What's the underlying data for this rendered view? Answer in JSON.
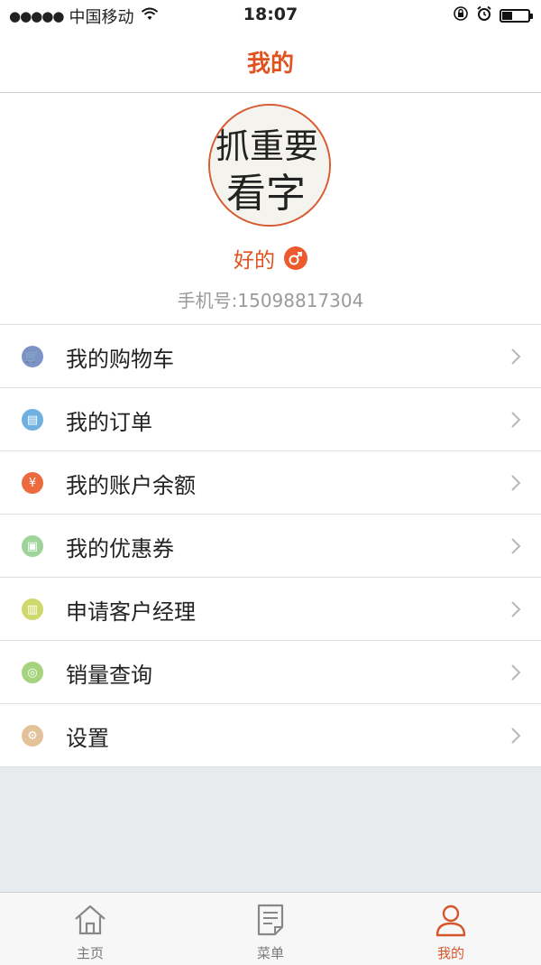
{
  "status_bar": {
    "signal_dots": "●●●●●",
    "carrier": "中国移动",
    "time": "18:07",
    "battery_level": 0.4
  },
  "header": {
    "title": "我的"
  },
  "profile": {
    "avatar_text_line1": "抓重要",
    "avatar_text_line2": "看字",
    "username": "好的",
    "gender_symbol": "♂",
    "phone_label": "手机号:15098817304"
  },
  "menu": {
    "items": [
      {
        "label": "我的购物车",
        "icon": "cart-icon",
        "color": "#7d93c7",
        "glyph": "🛒"
      },
      {
        "label": "我的订单",
        "icon": "order-icon",
        "color": "#6fb0e0",
        "glyph": "▤"
      },
      {
        "label": "我的账户余额",
        "icon": "yuan-icon",
        "color": "#ec6a3d",
        "glyph": "¥"
      },
      {
        "label": "我的优惠券",
        "icon": "coupon-icon",
        "color": "#9ed39a",
        "glyph": "▣"
      },
      {
        "label": "申请客户经理",
        "icon": "manager-icon",
        "color": "#cfd96b",
        "glyph": "▥"
      },
      {
        "label": "销量查询",
        "icon": "search-icon",
        "color": "#a6d37e",
        "glyph": "◎"
      },
      {
        "label": "设置",
        "icon": "gear-icon",
        "color": "#e3c29a",
        "glyph": "⚙"
      }
    ]
  },
  "tabs": [
    {
      "label": "主页",
      "icon": "home-icon"
    },
    {
      "label": "菜单",
      "icon": "menu-doc-icon"
    },
    {
      "label": "我的",
      "icon": "person-icon"
    }
  ],
  "colors": {
    "accent": "#e0521f",
    "background": "#e8ebee"
  }
}
